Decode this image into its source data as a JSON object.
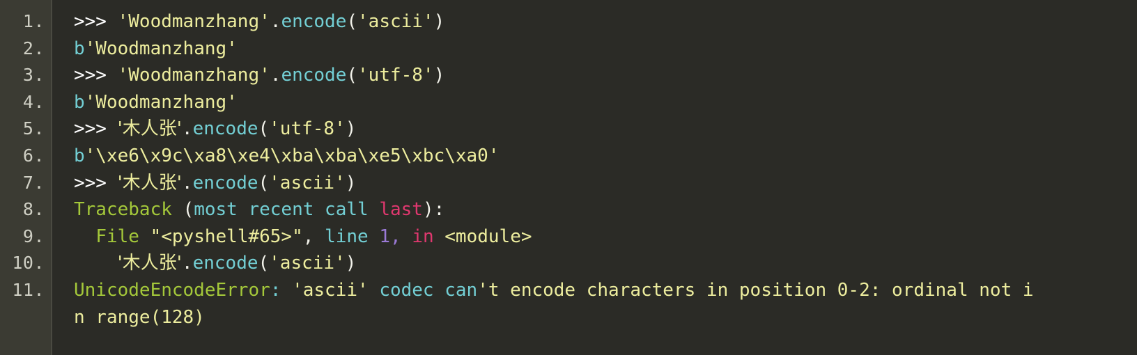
{
  "block": {
    "name": "python-repl-code-block",
    "language": "Python",
    "theme": {
      "background": "#2b2b26",
      "gutter_background": "#3b3b33",
      "gutter_border": "#4a4a41",
      "gutter_text": "#cfcfc4",
      "plain": "#f2f2ea",
      "prompt": "#ffffff",
      "string": "#eded9e",
      "builtin": "#73cfd4",
      "name": "#a4c83a",
      "keyword": "#e0386f",
      "number": "#9b7ad6"
    }
  },
  "gutter": {
    "numbers": [
      "1.",
      "2.",
      "3.",
      "4.",
      "5.",
      "6.",
      "7.",
      "8.",
      "9.",
      "10.",
      "11.",
      ""
    ]
  },
  "lines": [
    {
      "number": "1.",
      "plain_text": ">>> 'Woodmanzhang'.encode('ascii')",
      "tokens": [
        {
          "t": ">>> ",
          "c": "prompt"
        },
        {
          "t": "'Woodmanzhang'",
          "c": "string"
        },
        {
          "t": ".",
          "c": "punct"
        },
        {
          "t": "encode",
          "c": "builtin"
        },
        {
          "t": "(",
          "c": "punct"
        },
        {
          "t": "'ascii'",
          "c": "string"
        },
        {
          "t": ")",
          "c": "punct"
        }
      ]
    },
    {
      "number": "2.",
      "plain_text": "b'Woodmanzhang'",
      "tokens": [
        {
          "t": "b",
          "c": "builtin"
        },
        {
          "t": "'Woodmanzhang'",
          "c": "string"
        }
      ]
    },
    {
      "number": "3.",
      "plain_text": ">>> 'Woodmanzhang'.encode('utf-8')",
      "tokens": [
        {
          "t": ">>> ",
          "c": "prompt"
        },
        {
          "t": "'Woodmanzhang'",
          "c": "string"
        },
        {
          "t": ".",
          "c": "punct"
        },
        {
          "t": "encode",
          "c": "builtin"
        },
        {
          "t": "(",
          "c": "punct"
        },
        {
          "t": "'utf-8'",
          "c": "string"
        },
        {
          "t": ")",
          "c": "punct"
        }
      ]
    },
    {
      "number": "4.",
      "plain_text": "b'Woodmanzhang'",
      "tokens": [
        {
          "t": "b",
          "c": "builtin"
        },
        {
          "t": "'Woodmanzhang'",
          "c": "string"
        }
      ]
    },
    {
      "number": "5.",
      "plain_text": ">>> '木人张'.encode('utf-8')",
      "tokens": [
        {
          "t": ">>> ",
          "c": "prompt"
        },
        {
          "t": "'木人张'",
          "c": "string"
        },
        {
          "t": ".",
          "c": "punct"
        },
        {
          "t": "encode",
          "c": "builtin"
        },
        {
          "t": "(",
          "c": "punct"
        },
        {
          "t": "'utf-8'",
          "c": "string"
        },
        {
          "t": ")",
          "c": "punct"
        }
      ]
    },
    {
      "number": "6.",
      "plain_text": "b'\\xe6\\x9c\\xa8\\xe4\\xba\\xba\\xe5\\xbc\\xa0'",
      "tokens": [
        {
          "t": "b",
          "c": "builtin"
        },
        {
          "t": "'\\xe6\\x9c\\xa8\\xe4\\xba\\xba\\xe5\\xbc\\xa0'",
          "c": "string"
        }
      ]
    },
    {
      "number": "7.",
      "plain_text": ">>> '木人张'.encode('ascii')",
      "tokens": [
        {
          "t": ">>> ",
          "c": "prompt"
        },
        {
          "t": "'木人张'",
          "c": "string"
        },
        {
          "t": ".",
          "c": "punct"
        },
        {
          "t": "encode",
          "c": "builtin"
        },
        {
          "t": "(",
          "c": "punct"
        },
        {
          "t": "'ascii'",
          "c": "string"
        },
        {
          "t": ")",
          "c": "punct"
        }
      ]
    },
    {
      "number": "8.",
      "plain_text": "Traceback (most recent call last):",
      "tokens": [
        {
          "t": "Traceback",
          "c": "name"
        },
        {
          "t": " ",
          "c": "plain"
        },
        {
          "t": "(",
          "c": "punct"
        },
        {
          "t": "most recent call ",
          "c": "builtin"
        },
        {
          "t": "last",
          "c": "keyword"
        },
        {
          "t": "):",
          "c": "punct"
        }
      ]
    },
    {
      "number": "9.",
      "plain_text": "  File \"<pyshell#65>\", line 1, in <module>",
      "tokens": [
        {
          "t": "  ",
          "c": "plain"
        },
        {
          "t": "File",
          "c": "name"
        },
        {
          "t": " ",
          "c": "plain"
        },
        {
          "t": "\"<pyshell#65>\"",
          "c": "string"
        },
        {
          "t": ", ",
          "c": "punct"
        },
        {
          "t": "line",
          "c": "builtin"
        },
        {
          "t": " ",
          "c": "plain"
        },
        {
          "t": "1",
          "c": "number"
        },
        {
          "t": ", ",
          "c": "number"
        },
        {
          "t": "in",
          "c": "keyword"
        },
        {
          "t": " ",
          "c": "plain"
        },
        {
          "t": "<module>",
          "c": "string"
        }
      ]
    },
    {
      "number": "10.",
      "plain_text": "    '木人张'.encode('ascii')",
      "tokens": [
        {
          "t": "    ",
          "c": "plain"
        },
        {
          "t": "'木人张'",
          "c": "string"
        },
        {
          "t": ".",
          "c": "punct"
        },
        {
          "t": "encode",
          "c": "builtin"
        },
        {
          "t": "(",
          "c": "punct"
        },
        {
          "t": "'ascii'",
          "c": "string"
        },
        {
          "t": ")",
          "c": "punct"
        }
      ]
    },
    {
      "number": "11.",
      "plain_text": "UnicodeEncodeError: 'ascii' codec can't encode characters in position 0-2: ordinal not i",
      "tokens": [
        {
          "t": "UnicodeEncodeError",
          "c": "name"
        },
        {
          "t": ":",
          "c": "builtin"
        },
        {
          "t": " ",
          "c": "plain"
        },
        {
          "t": "'ascii'",
          "c": "string"
        },
        {
          "t": " ",
          "c": "plain"
        },
        {
          "t": "codec can",
          "c": "builtin"
        },
        {
          "t": "'t encode characters in position 0-2: ordinal not i",
          "c": "string"
        }
      ]
    },
    {
      "number": "",
      "plain_text": "n range(128)",
      "tokens": [
        {
          "t": "n range(128)",
          "c": "string"
        }
      ]
    }
  ]
}
